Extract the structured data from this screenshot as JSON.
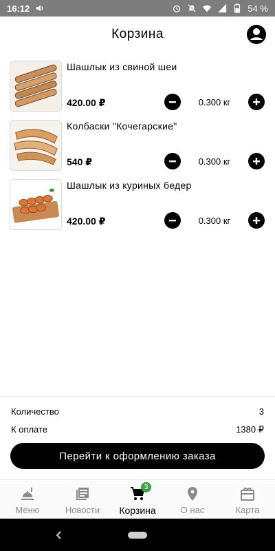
{
  "status_bar": {
    "time": "16:12",
    "battery": "54 %",
    "icons": [
      "volume-icon",
      "alarm-icon",
      "mute-icon",
      "wifi-icon",
      "signal-icon",
      "battery-icon"
    ]
  },
  "header": {
    "title": "Корзина",
    "account_icon": "account-icon"
  },
  "cart": {
    "items": [
      {
        "name": "Шашлык из свиной шеи",
        "price": "420.00 ₽",
        "quantity": "0.300 кг"
      },
      {
        "name": "Колбаски \"Кочегарские\"",
        "price": "540 ₽",
        "quantity": "0.300 кг"
      },
      {
        "name": "Шашлык из куриных бедер",
        "price": "420.00 ₽",
        "quantity": "0.300 кг"
      }
    ]
  },
  "summary": {
    "count_label": "Количество",
    "count_value": "3",
    "total_label": "К оплате",
    "total_value": "1380 ₽",
    "checkout_label": "Перейти к оформлению заказа"
  },
  "bottom_nav": {
    "items": [
      {
        "label": "Меню",
        "icon": "menu-food-icon"
      },
      {
        "label": "Новости",
        "icon": "news-icon"
      },
      {
        "label": "Корзина",
        "icon": "cart-icon",
        "badge": "3",
        "active": true
      },
      {
        "label": "О нас",
        "icon": "location-pin-icon"
      },
      {
        "label": "Карта",
        "icon": "gift-card-icon"
      }
    ]
  },
  "colors": {
    "status_bar": "#7d7d7d",
    "accent": "#000000",
    "badge": "#3aa34a",
    "inactive": "#8a8a8a"
  }
}
